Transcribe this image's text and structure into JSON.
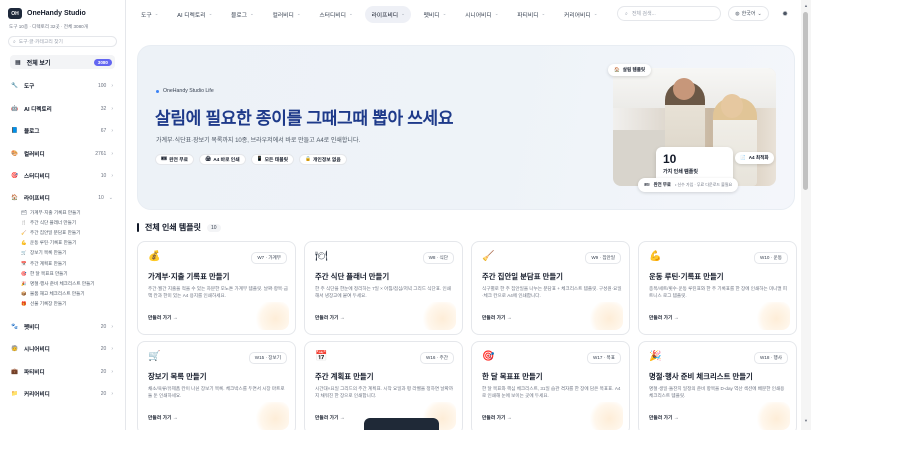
{
  "sidebar": {
    "brand": "OneHandy Studio",
    "stats": "도구 10종 · 디렉토리 32곳 · 전체 3080개",
    "search_placeholder": "도구·글·카테고리 찾기",
    "all_view": {
      "label": "전체 보기",
      "count": "3080"
    },
    "categories_top": [
      {
        "icon": "🔧",
        "label": "도구",
        "count": "100"
      },
      {
        "icon": "🤖",
        "label": "AI 디렉토리",
        "count": "32"
      },
      {
        "icon": "📘",
        "label": "블로그",
        "count": "67"
      },
      {
        "icon": "🎨",
        "label": "컬러비디",
        "count": "2761"
      },
      {
        "icon": "🎯",
        "label": "스터디비디",
        "count": "10"
      },
      {
        "icon": "🏠",
        "label": "라이프비디",
        "count": "10"
      }
    ],
    "sub_items": [
      {
        "icon": "🗂",
        "label": "가계부·지출 기록표 만들기"
      },
      {
        "icon": "🍴",
        "label": "주간 식단 플래너 만들기"
      },
      {
        "icon": "🧹",
        "label": "주간 집안일 분담표 만들기"
      },
      {
        "icon": "💪",
        "label": "운동 루틴·기록표 만들기"
      },
      {
        "icon": "🛒",
        "label": "장보기 목록 만들기"
      },
      {
        "icon": "📅",
        "label": "주간 계획표 만들기"
      },
      {
        "icon": "🎯",
        "label": "한 달 목표표 만들기"
      },
      {
        "icon": "🎉",
        "label": "명절·행사 준비 체크리스트 만들기"
      },
      {
        "icon": "📦",
        "label": "물품 재고 체크리스트 만들기"
      },
      {
        "icon": "🎁",
        "label": "선물 기록장 만들기"
      }
    ],
    "categories_bottom": [
      {
        "icon": "🐾",
        "label": "펫비디",
        "count": "20"
      },
      {
        "icon": "🧓",
        "label": "시니어비디",
        "count": "20"
      },
      {
        "icon": "💼",
        "label": "파티비디",
        "count": "20"
      },
      {
        "icon": "📁",
        "label": "커리어비디",
        "count": "20"
      }
    ]
  },
  "topnav": {
    "items": [
      {
        "label": "도구",
        "active": false
      },
      {
        "label": "AI 디렉토리",
        "active": false
      },
      {
        "label": "블로그",
        "active": false
      },
      {
        "label": "컬러비디",
        "active": false
      },
      {
        "label": "스터디비디",
        "active": false
      },
      {
        "label": "라이프비디",
        "active": true
      },
      {
        "label": "펫비디",
        "active": false
      },
      {
        "label": "시니어비디",
        "active": false
      },
      {
        "label": "파티비디",
        "active": false
      },
      {
        "label": "커리어비디",
        "active": false
      }
    ],
    "search_placeholder": "전체 검색...",
    "language": "한국어"
  },
  "hero": {
    "eyebrow": "OneHandy Studio Life",
    "title": "살림에 필요한 종이를 그때그때 뽑아 쓰세요",
    "description": "가계부·식단표·장보기 목록까지 10종, 브라우저에서 바로 만들고 A4로 인쇄합니다.",
    "chips": [
      {
        "icon": "🎟",
        "label": "완전 무료"
      },
      {
        "icon": "🖨",
        "label": "A4 바로 인쇄"
      },
      {
        "icon": "📱",
        "label": "모든 태블릿"
      },
      {
        "icon": "🔒",
        "label": "개인정보 없음"
      }
    ],
    "badge_top": "살림 템플릿",
    "count_number": "10",
    "count_label": "가지 인쇄 템플릿",
    "badge_right": "A4 최적화",
    "badge_bottom_title": "완전 무료",
    "badge_bottom_sub": "• 신수 가입 · 무료 다운로드 불필요"
  },
  "section": {
    "title": "전체 인쇄 템플릿",
    "count": "10"
  },
  "cards": [
    {
      "icon": "💰",
      "tag": "W7 · 가계부",
      "title": "가계부·지출 기록표 만들기",
      "desc": "주간·월간 지출을 적을 수 있는 차분한 모노톤 가계부 템플릿. 날짜·항목·금액 칸과 한미 있는 A4 용지를 인쇄하세요.",
      "link": "만들러 가기 →"
    },
    {
      "icon": "🍽",
      "tag": "W8 · 식단",
      "title": "주간 식단 플래너 만들기",
      "desc": "한 주 식단을 한눈에 정리하는 7일 × 아침/점심/저녁 그리드 식단표. 인쇄해서 냉장고에 붙여 두세요.",
      "link": "만들러 가기 →"
    },
    {
      "icon": "🧹",
      "tag": "W9 · 집안일",
      "title": "주간 집안일 분담표 만들기",
      "desc": "식구별로 한 주 집안일을 나누는 분담표 + 체크리스트 템플릿. 구성원·요일·체크 칸으로 A4에 인쇄합니다.",
      "link": "만들러 가기 →"
    },
    {
      "icon": "💪",
      "tag": "W10 · 운동",
      "title": "운동 루틴·기록표 만들기",
      "desc": "종목/세트/횟수·운동 루틴표와 한 주 기록표를 한 장에 인쇄하는 미니멀 피트니스 로그 템플릿.",
      "link": "만들러 가기 →"
    },
    {
      "icon": "🛒",
      "tag": "W15 · 장보기",
      "title": "장보기 목록 만들기",
      "desc": "채소/육류/유제품 칸이 나뉜 장보기 목록. 체크박스를 두면서 시장 마트로 둘 둔 인쇄하세요.",
      "link": "만들러 가기 →"
    },
    {
      "icon": "📅",
      "tag": "W16 · 주간",
      "title": "주간 계획표 만들기",
      "desc": "시간대×요일 그리드의 주간 계획표. 시작 요일과 평 라벨을 정하면 날짜까지 채워진 한 장으로 인쇄합니다.",
      "link": "만들러 가기 →"
    },
    {
      "icon": "🎯",
      "tag": "W17 · 목표",
      "title": "한 달 목표표 만들기",
      "desc": "한 달 목표와 핵심 체크리스트, 31일 습관 격자를 한 장에 담은 목표표. A4로 인쇄해 눈에 보이는 곳에 두세요.",
      "link": "만들러 가기 →"
    },
    {
      "icon": "🎉",
      "tag": "W18 · 행사",
      "title": "명절·행사 준비 체크리스트 만들기",
      "desc": "명절·생일·돌잔치 일정의 준비 항목을 D-day 역산 섹션에 배분한 인쇄용 체크리스트 템플릿.",
      "link": "만들러 가기 →"
    }
  ]
}
